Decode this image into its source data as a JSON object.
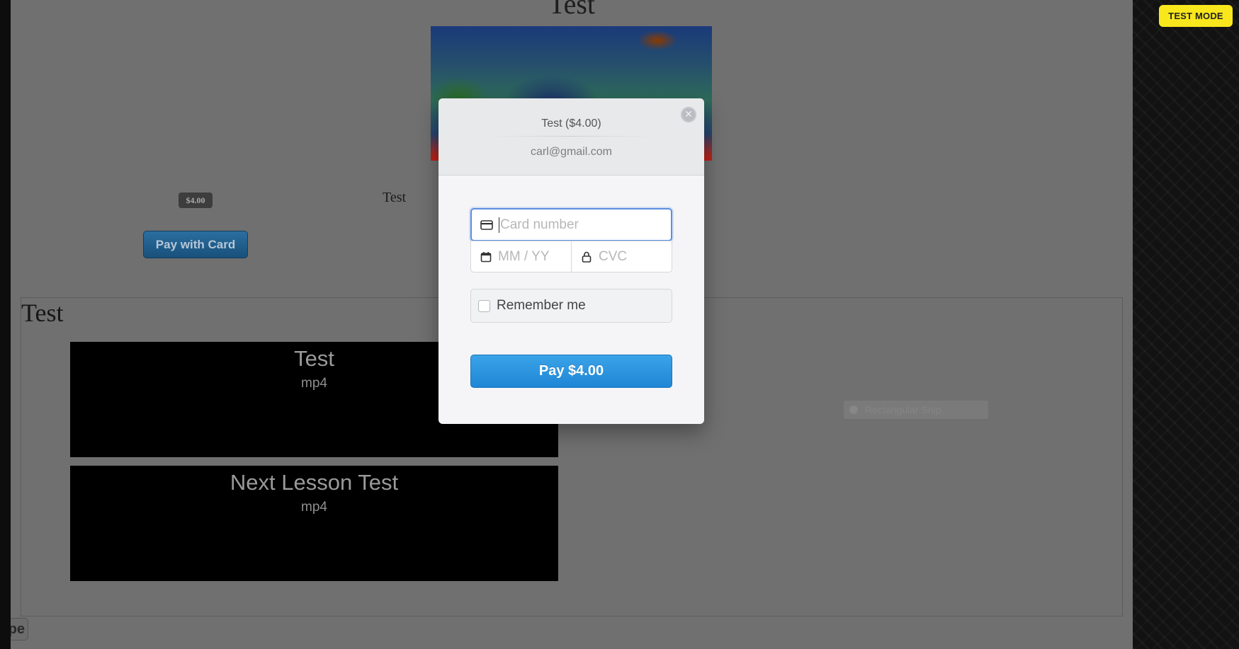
{
  "page": {
    "title": "Test",
    "price_badge": "$4.00",
    "product_name": "Test",
    "pay_with_card_label": "Pay with Card",
    "section_title": "Test",
    "lessons": [
      {
        "title": "Test",
        "format": "mp4"
      },
      {
        "title": "Next Lesson Test",
        "format": "mp4"
      }
    ],
    "ghost_chip_label": "Rectangular Snip",
    "corner_tab_label": "pe"
  },
  "test_mode_badge": "TEST MODE",
  "checkout": {
    "title": "Test ($4.00)",
    "email": "carl@gmail.com",
    "card_number_placeholder": "Card number",
    "expiry_placeholder": "MM / YY",
    "cvc_placeholder": "CVC",
    "remember_me_label": "Remember me",
    "pay_button_label": "Pay $4.00",
    "icons": {
      "close": "close-icon",
      "card": "credit-card-icon",
      "calendar": "calendar-icon",
      "lock": "lock-icon"
    }
  },
  "colors": {
    "pay_button": "#2493df",
    "test_mode": "#f8e71c",
    "focus_border": "#5c8fe0"
  }
}
